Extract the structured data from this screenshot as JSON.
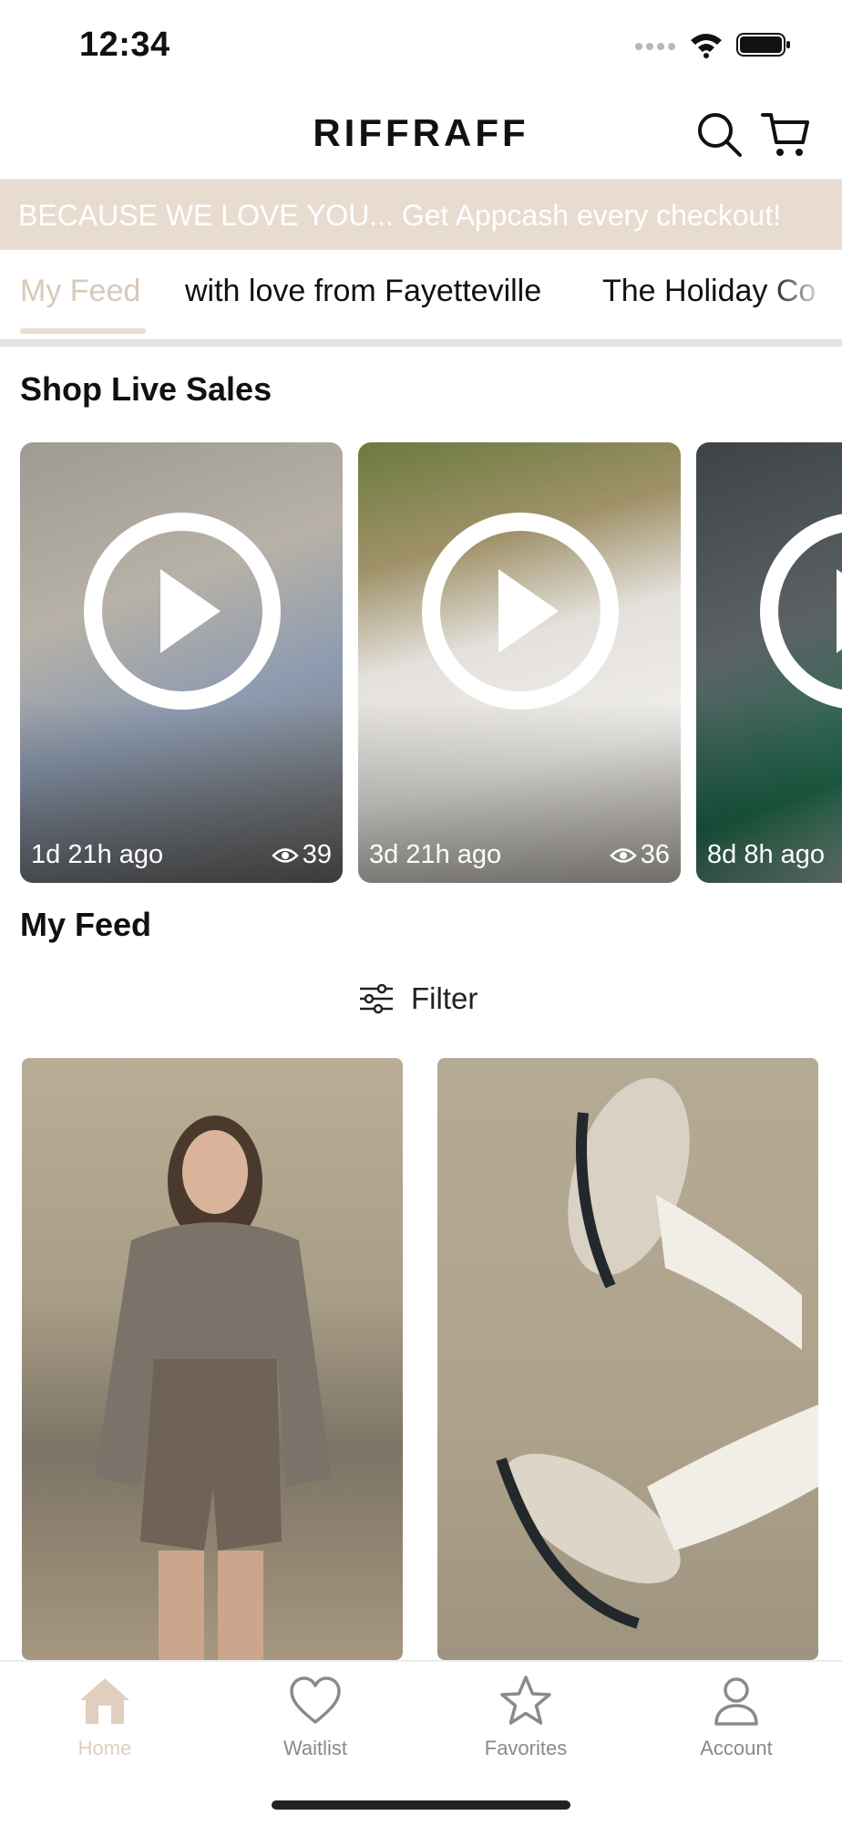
{
  "status_bar": {
    "time": "12:34"
  },
  "header": {
    "brand": "RIFFRAFF",
    "search_icon": "search-icon",
    "cart_icon": "cart-icon"
  },
  "promo": {
    "text": "BECAUSE WE LOVE YOU... Get Appcash every checkout!"
  },
  "tabs": [
    {
      "label": "My Feed",
      "active": true
    },
    {
      "label": "with love from Fayetteville",
      "active": false
    },
    {
      "label": "The Holiday Co",
      "active": false
    }
  ],
  "live_section": {
    "title": "Shop Live Sales",
    "cards": [
      {
        "ago": "1d 21h ago",
        "views": "39"
      },
      {
        "ago": "3d 21h ago",
        "views": "36"
      },
      {
        "ago": "8d 8h ago",
        "views": ""
      }
    ]
  },
  "feed_section": {
    "title": "My Feed",
    "filter_label": "Filter"
  },
  "bottom_nav": [
    {
      "label": "Home",
      "icon": "home-icon",
      "active": true
    },
    {
      "label": "Waitlist",
      "icon": "heart-icon",
      "active": false
    },
    {
      "label": "Favorites",
      "icon": "star-icon",
      "active": false
    },
    {
      "label": "Account",
      "icon": "person-icon",
      "active": false
    }
  ],
  "colors": {
    "accent": "#e8dcd0",
    "active_tab": "#d9c9b8",
    "nav_inactive": "#8a8a8a"
  }
}
